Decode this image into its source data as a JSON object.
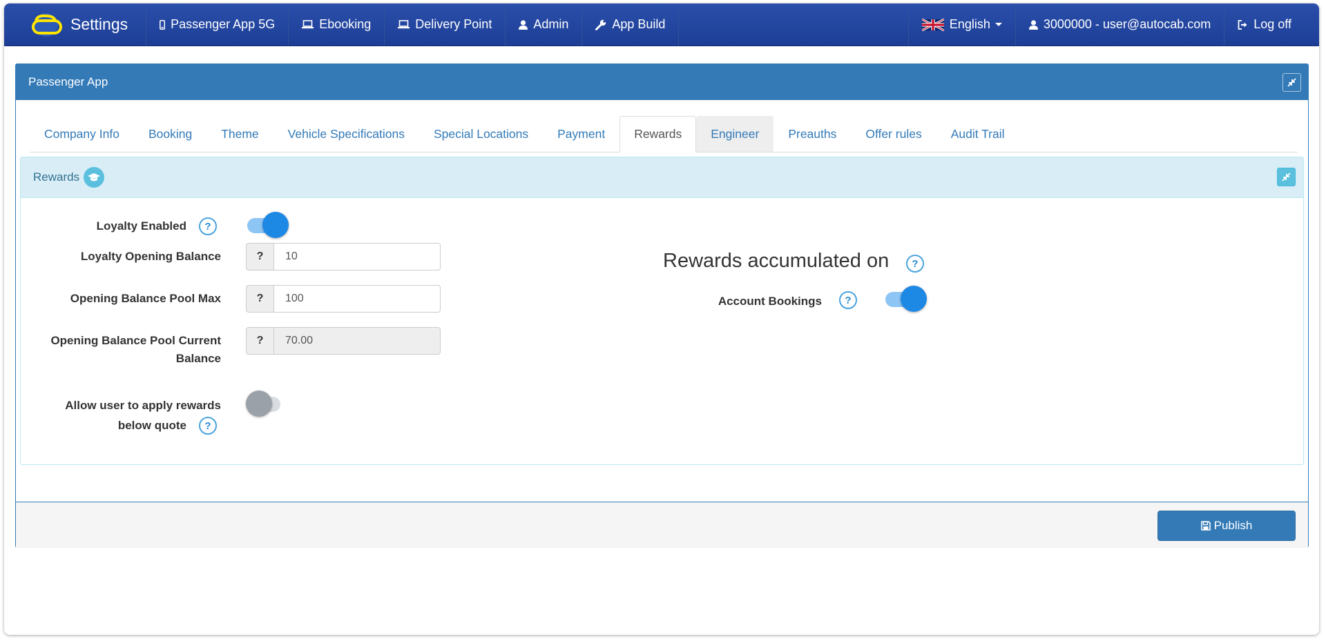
{
  "navbar": {
    "brand": "Settings",
    "items": [
      {
        "label": "Passenger App 5G",
        "icon": "mobile-icon"
      },
      {
        "label": "Ebooking",
        "icon": "laptop-icon"
      },
      {
        "label": "Delivery Point",
        "icon": "laptop-icon"
      },
      {
        "label": "Admin",
        "icon": "user-icon"
      },
      {
        "label": "App Build",
        "icon": "wrench-icon"
      }
    ],
    "language": "English",
    "user": "3000000 - user@autocab.com",
    "logoff": "Log off"
  },
  "panel": {
    "title": "Passenger App",
    "tabs": [
      "Company Info",
      "Booking",
      "Theme",
      "Vehicle Specifications",
      "Special Locations",
      "Payment",
      "Rewards",
      "Engineer",
      "Preauths",
      "Offer rules",
      "Audit Trail"
    ],
    "active_tab": "Rewards"
  },
  "rewards": {
    "title": "Rewards",
    "loyalty_enabled_label": "Loyalty Enabled",
    "loyalty_enabled": true,
    "opening_balance_label": "Loyalty Opening Balance",
    "opening_balance": "10",
    "pool_max_label": "Opening Balance Pool Max",
    "pool_max": "100",
    "pool_current_label_1": "Opening Balance Pool Current",
    "pool_current_label_2": "Balance",
    "pool_current": "70.00",
    "below_quote_label_1": "Allow user to apply rewards",
    "below_quote_label_2": "below quote",
    "below_quote": false,
    "addon": "?",
    "help": "?",
    "accumulated_title": "Rewards accumulated on",
    "account_bookings_label": "Account Bookings",
    "account_bookings": true
  },
  "footer": {
    "publish": "Publish"
  },
  "colors": {
    "navbar": "#1d3e96",
    "primary": "#337ab7",
    "info_bg": "#d9edf7",
    "toggle_on": "#1e88e5",
    "logo": "#ffe500"
  }
}
